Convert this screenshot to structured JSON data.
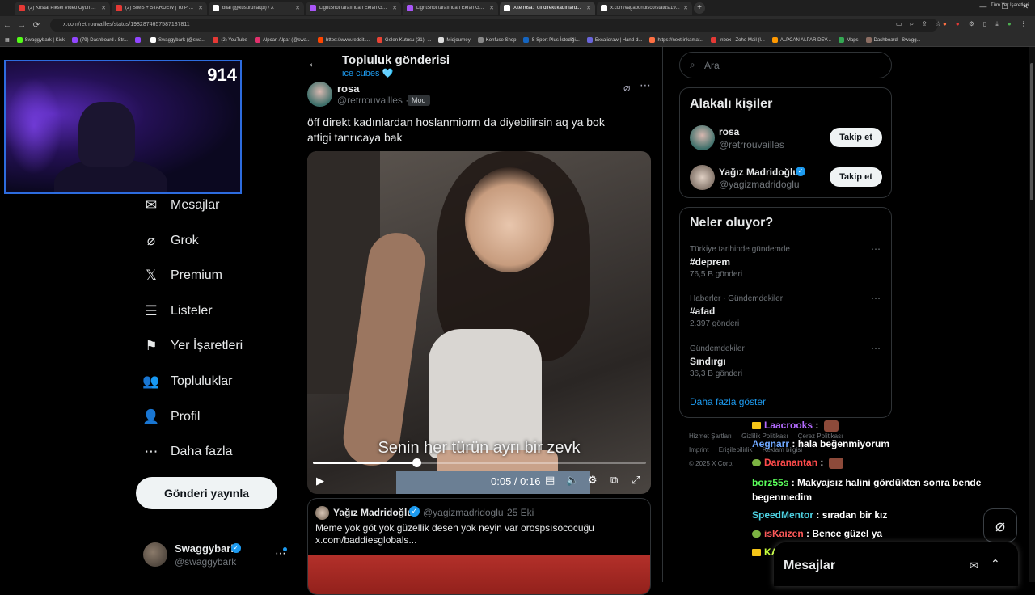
{
  "browser": {
    "tabs": [
      {
        "label": "(2) Kristal Piksel Video Oyun O...",
        "color": "#e53935"
      },
      {
        "label": "(2) SIMS + STARDEW | To Pixel...",
        "color": "#e53935"
      },
      {
        "label": "bilal (@kusurunakpl) / X",
        "color": "#ffffff"
      },
      {
        "label": "LightShot tarafından Ekran Gör...",
        "color": "#a855f7"
      },
      {
        "label": "LightShot tarafından Ekran Gör...",
        "color": "#a855f7"
      },
      {
        "label": "X'te rosa: \"öff direkt kadınlard...",
        "color": "#ffffff"
      },
      {
        "label": "x.com/vagabondisco/status/19...",
        "color": "#ffffff"
      }
    ],
    "url": "x.com/retrrouvailles/status/1982874657587187811",
    "bookmarks": [
      {
        "label": "Swaggybark | Kick",
        "color": "#53fc18"
      },
      {
        "label": "(79) Dashboard / Str...",
        "color": "#9146ff"
      },
      {
        "label": "",
        "color": "#9146ff"
      },
      {
        "label": "Swaggybark (@swa...",
        "color": "#ffffff"
      },
      {
        "label": "(2) YouTube",
        "color": "#e53935"
      },
      {
        "label": "Alpcan Alpar (@swa...",
        "color": "#e1306c"
      },
      {
        "label": "https://www.reddit....",
        "color": "#ff4500"
      },
      {
        "label": "Gelen Kutusu (31) -...",
        "color": "#ea4335"
      },
      {
        "label": "Midjourney",
        "color": "#dddddd"
      },
      {
        "label": "Konfuse Shop",
        "color": "#888888"
      },
      {
        "label": "S Sport Plus-İstediği...",
        "color": "#1565c0"
      },
      {
        "label": "Excalidraw | Hand-d...",
        "color": "#6965db"
      },
      {
        "label": "https://next.inkamat...",
        "color": "#ff7043"
      },
      {
        "label": "Inbox - Zoho Mail (l...",
        "color": "#e53935"
      },
      {
        "label": "ALPCAN ALPAR DEV...",
        "color": "#ff9800"
      },
      {
        "label": "Maps",
        "color": "#34a853"
      },
      {
        "label": "Dashboard - Swagg...",
        "color": "#8d6e63"
      }
    ],
    "all_bookmarks": "Tüm Yer İşaretleri"
  },
  "webcam": {
    "count": "914"
  },
  "sidebar": {
    "items": [
      {
        "label": "Mesajlar",
        "icon": "✉"
      },
      {
        "label": "Grok",
        "icon": "⌀"
      },
      {
        "label": "Premium",
        "icon": "𝕏"
      },
      {
        "label": "Listeler",
        "icon": "☰"
      },
      {
        "label": "Yer İşaretleri",
        "icon": "⚑"
      },
      {
        "label": "Topluluklar",
        "icon": "👥"
      },
      {
        "label": "Profil",
        "icon": "👤"
      },
      {
        "label": "Daha fazla",
        "icon": "⋯"
      }
    ],
    "post_button": "Gönderi yayınla",
    "account": {
      "name": "Swaggybark",
      "handle": "@swaggybark"
    }
  },
  "header": {
    "title": "Topluluk gönderisi",
    "subtitle": "ice cubes 🩵"
  },
  "post": {
    "name": "rosa",
    "handle": "@retrrouvailles ·",
    "badge": "Mod",
    "text": "öff direkt kadınlardan hoslanmiorm da diyebilirsin aq ya bok attigi tanrıcaya bak",
    "video": {
      "subtitle": "Senin her türün ayrı bir zevk",
      "time": "0:05 / 0:16",
      "progress": 0.31
    }
  },
  "quote": {
    "name": "Yağız Madridoğlu",
    "handle": "@yagizmadridoglu ·",
    "date": "25 Eki",
    "text": "Meme yok göt yok güzellik desen yok neyin var orospsısococuğu x.com/baddiesglobals..."
  },
  "search": {
    "placeholder": "Ara"
  },
  "people": {
    "title": "Alakalı kişiler",
    "items": [
      {
        "name": "rosa",
        "handle": "@retrrouvailles",
        "follow": "Takip et",
        "verified": false
      },
      {
        "name": "Yağız Madridoğlu",
        "handle": "@yagizmadridoglu",
        "follow": "Takip et",
        "verified": true
      }
    ]
  },
  "trends": {
    "title": "Neler oluyor?",
    "items": [
      {
        "context": "Türkiye tarihinde gündemde",
        "name": "#deprem",
        "count": "76,5 B gönderi"
      },
      {
        "context": "Haberler · Gündemdekiler",
        "name": "#afad",
        "count": "2.397 gönderi"
      },
      {
        "context": "Gündemdekiler",
        "name": "Sındırgı",
        "count": "36,3 B gönderi"
      }
    ],
    "show_more": "Daha fazla göster"
  },
  "footer": {
    "links": [
      "Hizmet Şartları",
      "Gizlilik Politikası",
      "Çerez Politikası",
      "Imprint",
      "Erişilebilirlik",
      "Reklam bilgisi"
    ],
    "copyright": "© 2025 X Corp."
  },
  "chat": [
    {
      "user": "Laacrooks",
      "msg": "",
      "color": "#b36bff",
      "badge": "crown",
      "emote": true
    },
    {
      "user": "Aegnarr",
      "msg": "hala beğenmiyorum",
      "color": "#6fa8ff",
      "badge": "",
      "emote": false
    },
    {
      "user": "Daranantan",
      "msg": "",
      "color": "#ff4b4b",
      "badge": "sub",
      "emote": true
    },
    {
      "user": "borz55s",
      "msg": "Makyajsız halini gördükten sonra bende begenmedim",
      "color": "#5bff5b",
      "badge": "",
      "emote": false
    },
    {
      "user": "SpeedMentor",
      "msg": "sıradan bir kız",
      "color": "#4dd0e1",
      "badge": "",
      "emote": false
    },
    {
      "user": "isKaizen",
      "msg": "Bence güzel ya",
      "color": "#ff5a5a",
      "badge": "sub",
      "emote": false
    },
    {
      "user": "KAPTORXX",
      "msg": "",
      "color": "#c6ff3c",
      "badge": "crown",
      "emote": true
    }
  ],
  "messages_drawer": {
    "title": "Mesajlar"
  }
}
